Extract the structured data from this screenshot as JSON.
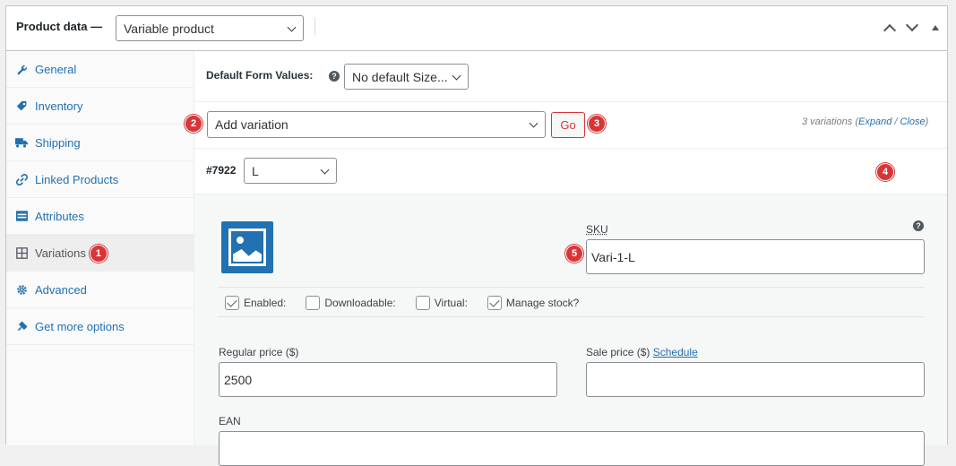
{
  "header": {
    "title": "Product data —",
    "product_type": "Variable product"
  },
  "sidebar": {
    "items": [
      {
        "label": "General",
        "icon": "wrench-icon"
      },
      {
        "label": "Inventory",
        "icon": "tag-icon"
      },
      {
        "label": "Shipping",
        "icon": "truck-icon"
      },
      {
        "label": "Linked Products",
        "icon": "link-icon"
      },
      {
        "label": "Attributes",
        "icon": "list-icon"
      },
      {
        "label": "Variations",
        "icon": "grid-icon"
      },
      {
        "label": "Advanced",
        "icon": "gear-icon"
      },
      {
        "label": "Get more options",
        "icon": "plugin-icon"
      }
    ]
  },
  "defaults": {
    "label": "Default Form Values:",
    "select_value": "No default Size..."
  },
  "actions": {
    "select_value": "Add variation",
    "go_label": "Go",
    "count_text": "3 variations",
    "expand": "Expand",
    "slash": " / ",
    "close": "Close"
  },
  "variation": {
    "id": "#7922",
    "size": "L",
    "sku_label": "SKU",
    "sku_value": "Vari-1-L",
    "enabled_label": "Enabled:",
    "downloadable_label": "Downloadable:",
    "virtual_label": "Virtual:",
    "manage_stock_label": "Manage stock?",
    "regular_price_label": "Regular price ($)",
    "regular_price_value": "2500",
    "sale_price_label": "Sale price ($)",
    "schedule_label": "Schedule",
    "ean_label": "EAN"
  },
  "badges": [
    "1",
    "2",
    "3",
    "4",
    "5"
  ],
  "colors": {
    "accent": "#2271b1",
    "badge": "#d63638"
  }
}
